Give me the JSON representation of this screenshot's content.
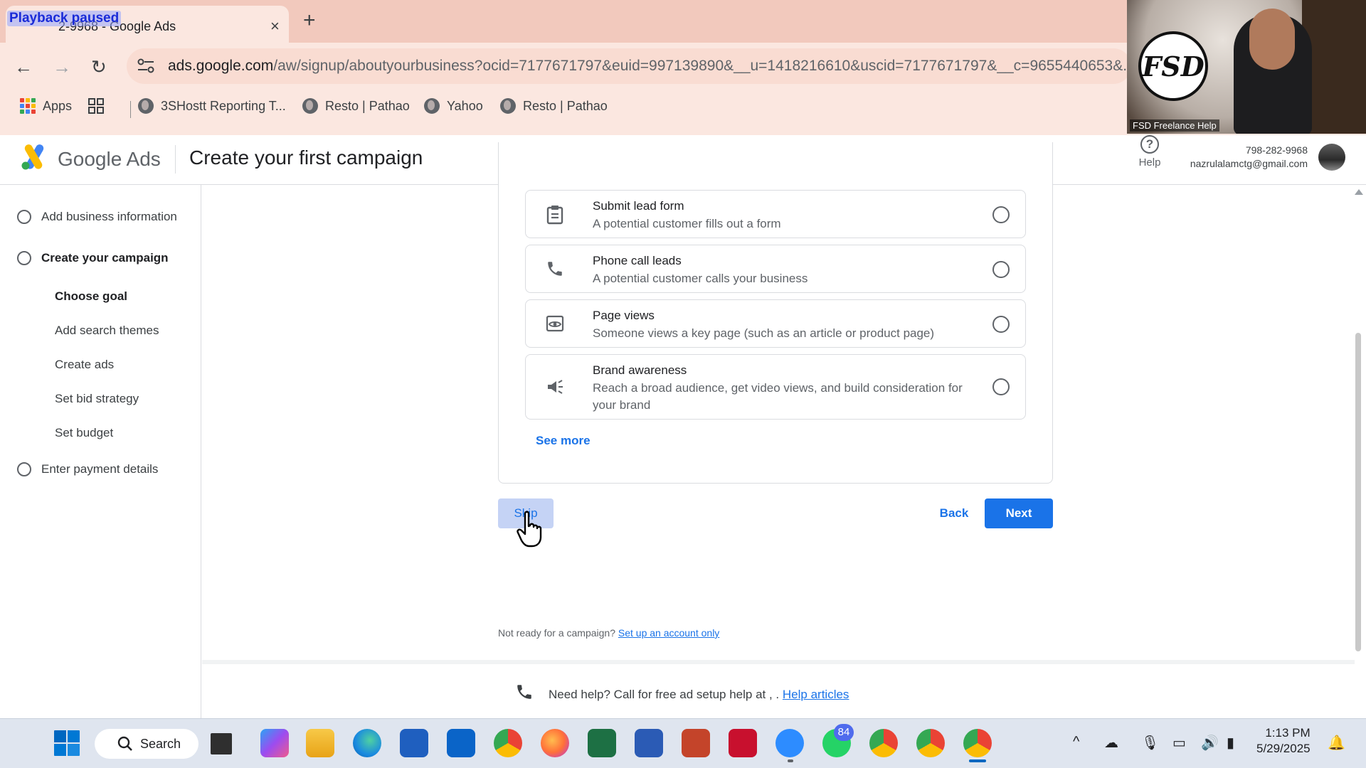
{
  "browser": {
    "overlay_text": "Playback paused",
    "tab_title": "2-9968 - Google Ads",
    "tab_close": "×",
    "new_tab": "+",
    "back": "←",
    "forward": "→",
    "reload": "↻",
    "url_host": "ads.google.com",
    "url_path": "/aw/signup/aboutyourbusiness?ocid=7177671797&euid=997139890&__u=1418216610&uscid=7177671797&__c=9655440653&..."
  },
  "bookmarks": [
    {
      "label": "Apps",
      "icon": "apps-grid-icon"
    },
    {
      "label": "",
      "icon": "tab-groups-icon"
    },
    {
      "label": "3SHostt Reporting T...",
      "icon": "globe-icon"
    },
    {
      "label": "Resto | Pathao",
      "icon": "globe-icon"
    },
    {
      "label": "Yahoo",
      "icon": "globe-icon"
    },
    {
      "label": "Resto | Pathao",
      "icon": "globe-icon"
    }
  ],
  "webcam": {
    "logo_text": "FSD",
    "caption": "FSD Freelance Help"
  },
  "header": {
    "product_name": "Google Ads",
    "page_title": "Create your first campaign",
    "help_label": "Help",
    "account_number": "798-282-9968",
    "account_email": "nazrulalamctg@gmail.com"
  },
  "sidebar": {
    "steps": [
      {
        "label": "Add business information"
      },
      {
        "label": "Create your campaign"
      },
      {
        "label": "Enter payment details"
      }
    ],
    "substeps": [
      {
        "label": "Choose goal",
        "active": true
      },
      {
        "label": "Add search themes"
      },
      {
        "label": "Create ads"
      },
      {
        "label": "Set bid strategy"
      },
      {
        "label": "Set budget"
      }
    ]
  },
  "goals": [
    {
      "title": "Submit lead form",
      "description": "A potential customer fills out a form",
      "icon": "clipboard-icon"
    },
    {
      "title": "Phone call leads",
      "description": "A potential customer calls your business",
      "icon": "phone-icon"
    },
    {
      "title": "Page views",
      "description": "Someone views a key page (such as an article or product page)",
      "icon": "eye-icon"
    },
    {
      "title": "Brand awareness",
      "description": "Reach a broad audience, get video views, and build consideration for your brand",
      "icon": "megaphone-icon"
    }
  ],
  "actions": {
    "see_more": "See more",
    "skip": "Skip",
    "back": "Back",
    "next": "Next"
  },
  "footer": {
    "not_ready_text": "Not ready for a campaign?",
    "setup_account_link": "Set up an account only",
    "help_text": "Need help? Call for free ad setup help at , .",
    "help_articles_link": "Help articles"
  },
  "taskbar": {
    "search_label": "Search",
    "whatsapp_badge": "84",
    "time": "1:13 PM",
    "date": "5/29/2025"
  },
  "colors": {
    "accent": "#1a73e8",
    "tab_strip": "#f2c9bd",
    "toolbar": "#fbe7e0"
  }
}
